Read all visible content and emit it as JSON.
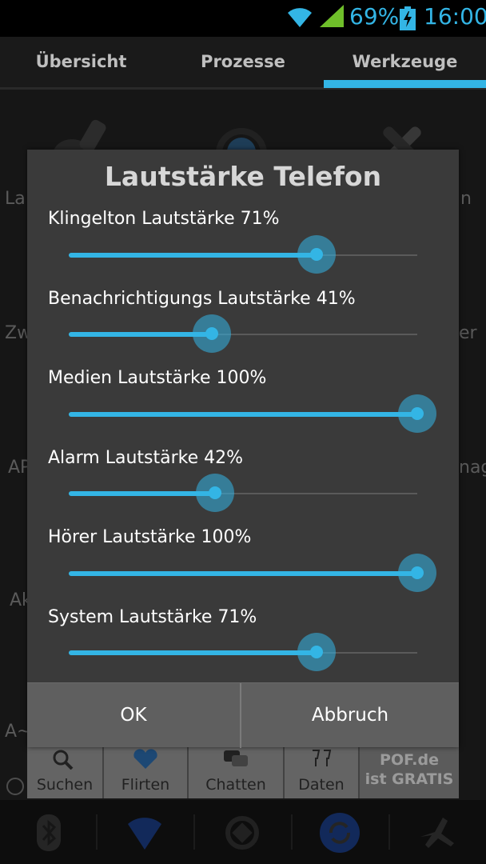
{
  "status_bar": {
    "battery_percent": "69%",
    "time": "16:00",
    "accent_color": "#33b5e5",
    "icons": [
      "wifi-icon",
      "signal-icon",
      "battery-charging-icon"
    ]
  },
  "tabs": [
    {
      "label": "Übersicht",
      "selected": false
    },
    {
      "label": "Prozesse",
      "selected": false
    },
    {
      "label": "Werkzeuge",
      "selected": true
    }
  ],
  "background": {
    "partial_labels": [
      "La",
      "n",
      "Zw",
      "er",
      "AP",
      "nag",
      "Ak",
      "A~"
    ]
  },
  "dialog": {
    "title": "Lautstärke Telefon",
    "sliders": [
      {
        "label": "Klingelton Lautstärke 71%",
        "value": 0.71
      },
      {
        "label": "Benachrichtigungs Lautstärke 41%",
        "value": 0.41
      },
      {
        "label": "Medien Lautstärke 100%",
        "value": 1.0
      },
      {
        "label": "Alarm Lautstärke 42%",
        "value": 0.42
      },
      {
        "label": "Hörer Lautstärke 100%",
        "value": 1.0
      },
      {
        "label": "System Lautstärke 71%",
        "value": 0.71
      }
    ],
    "ok_label": "OK",
    "cancel_label": "Abbruch"
  },
  "ad": {
    "items": [
      {
        "label": "Suchen",
        "icon": "magnifier-icon"
      },
      {
        "label": "Flirten",
        "icon": "heart-icon"
      },
      {
        "label": "Chatten",
        "icon": "chat-bubbles-icon"
      },
      {
        "label": "Daten",
        "icon": "glasses-toast-icon"
      }
    ],
    "pof_line1": "POF.de",
    "pof_line2": "ist GRATIS"
  },
  "toggles": [
    "bluetooth-icon",
    "wifi-toggle-icon",
    "gps-icon",
    "sync-icon",
    "airplane-icon"
  ]
}
